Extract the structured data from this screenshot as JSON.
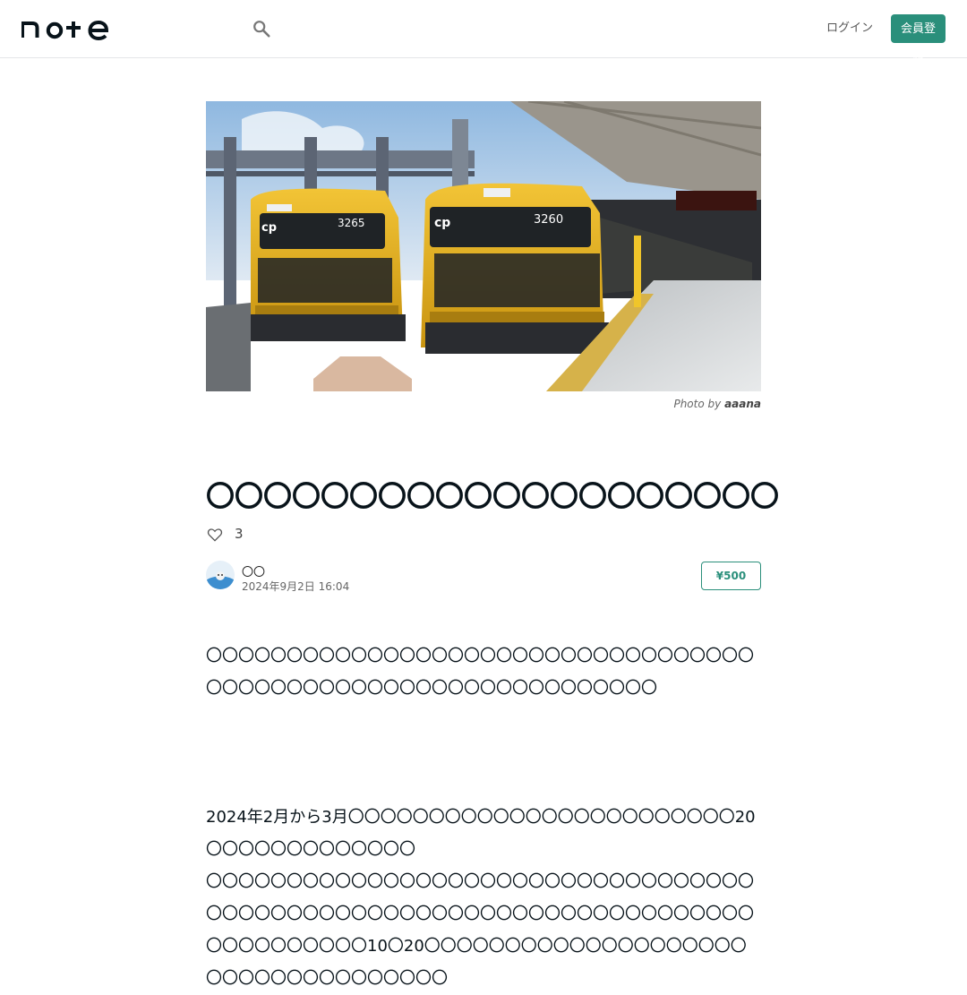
{
  "header": {
    "logo_text": "note",
    "login_label": "ログイン",
    "signup_label": "会員登録"
  },
  "eyecatch": {
    "alt": "Yellow commuter trains 3265 and 3260 at a station platform",
    "credit_prefix": "Photo by",
    "credit_author": "aaana",
    "train_numbers": [
      "3265",
      "3260"
    ]
  },
  "article": {
    "title": "〇〇〇〇〇〇〇〇〇〇〇〇〇〇〇〇〇〇〇〇",
    "like_count": "3",
    "author_name": "〇〇",
    "date": "2024年9月2日 16:04",
    "price": "¥500",
    "paragraphs": [
      "〇〇〇〇〇〇〇〇〇〇〇〇〇〇〇〇〇〇〇〇〇〇〇〇〇〇〇〇〇〇〇〇〇〇〇〇〇〇〇〇〇〇〇〇〇〇〇〇〇〇〇〇〇〇〇〇〇〇〇〇〇〇",
      "2024年2月から3月〇〇〇〇〇〇〇〇〇〇〇〇〇〇〇〇〇〇〇〇〇〇〇〇20〇〇〇〇〇〇〇〇〇〇〇〇〇",
      "〇〇〇〇〇〇〇〇〇〇〇〇〇〇〇〇〇〇〇〇〇〇〇〇〇〇〇〇〇〇〇〇〇〇〇〇〇〇〇〇〇〇〇〇〇〇〇〇〇〇〇〇〇〇〇〇〇〇〇〇〇〇〇〇〇〇〇〇〇〇〇〇〇〇〇〇〇〇10〇20〇〇〇〇〇〇〇〇〇〇〇〇〇〇〇〇〇〇〇〇〇〇〇〇〇〇〇〇〇〇〇〇〇〇〇"
    ]
  },
  "colors": {
    "accent": "#2a8f7b",
    "text": "#08131a",
    "train_yellow": "#e8b320"
  }
}
